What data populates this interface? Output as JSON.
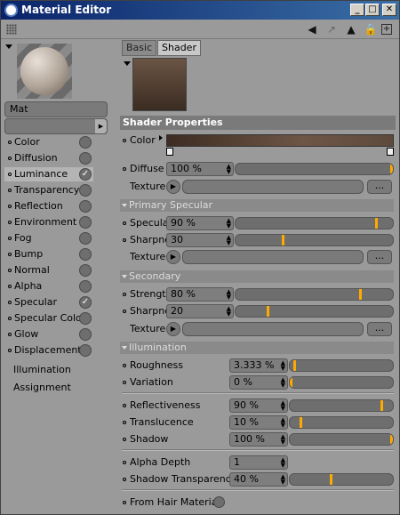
{
  "window": {
    "title": "Material Editor"
  },
  "material": {
    "name": "Mat"
  },
  "channels": [
    {
      "label": "Color",
      "checked": false
    },
    {
      "label": "Diffusion",
      "checked": false
    },
    {
      "label": "Luminance",
      "checked": true
    },
    {
      "label": "Transparency",
      "checked": false
    },
    {
      "label": "Reflection",
      "checked": false
    },
    {
      "label": "Environment",
      "checked": false
    },
    {
      "label": "Fog",
      "checked": false
    },
    {
      "label": "Bump",
      "checked": false
    },
    {
      "label": "Normal",
      "checked": false
    },
    {
      "label": "Alpha",
      "checked": false
    },
    {
      "label": "Specular",
      "checked": true
    },
    {
      "label": "Specular Color",
      "checked": false
    },
    {
      "label": "Glow",
      "checked": false
    },
    {
      "label": "Displacement",
      "checked": false
    }
  ],
  "extra_channels": [
    "Illumination",
    "Assignment"
  ],
  "tabs": {
    "basic": "Basic",
    "shader": "Shader"
  },
  "shader": {
    "section_title": "Shader Properties",
    "color_label": "Color",
    "diffuse_label": "Diffuse",
    "diffuse_value": "100 %",
    "texture_label": "Texture",
    "primary_specular": "Primary Specular",
    "specular_label": "Specular",
    "specular_value": "90 %",
    "sharpness_label": "Sharpness",
    "sharpness_value": "30",
    "secondary": "Secondary",
    "strength_label": "Strength",
    "strength_value": "80 %",
    "sharpness2_value": "20",
    "illumination": "Illumination",
    "roughness_label": "Roughness",
    "roughness_value": "3.333 %",
    "variation_label": "Variation",
    "variation_value": "0 %",
    "reflectiveness_label": "Reflectiveness",
    "reflectiveness_value": "90 %",
    "translucence_label": "Translucence",
    "translucence_value": "10 %",
    "shadow_label": "Shadow",
    "shadow_value": "100 %",
    "alpha_depth_label": "Alpha Depth",
    "alpha_depth_value": "1",
    "shadow_transparency_label": "Shadow Transparency",
    "shadow_transparency_value": "40 %",
    "hair_label": "From Hair Materials",
    "ellipsis": "...",
    "levels": {
      "diffuse": 1.0,
      "specular": 0.9,
      "sharpness": 0.3,
      "strength": 0.8,
      "sharpness2": 0.2,
      "roughness": 0.03333,
      "variation": 0.0,
      "reflectiveness": 0.9,
      "translucence": 0.1,
      "shadow": 1.0,
      "shadow_transparency": 0.4
    }
  },
  "colors": {
    "accent": "#ffaa00",
    "titlebar": "#0a246a"
  }
}
